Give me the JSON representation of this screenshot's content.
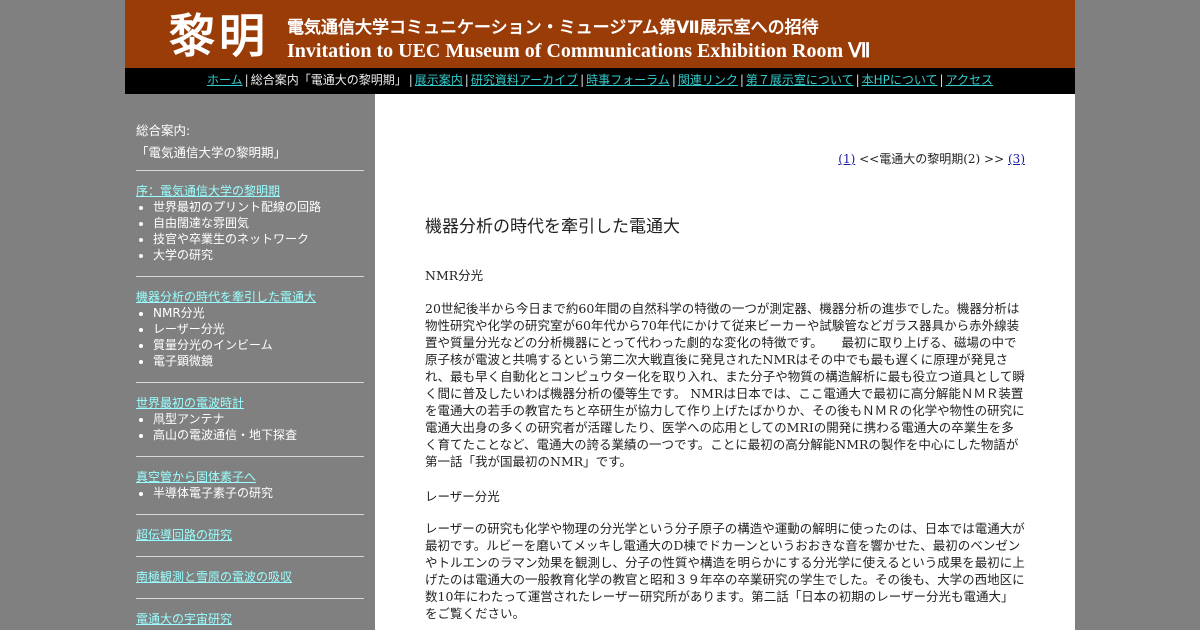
{
  "header": {
    "logo": "黎明",
    "title_jp": "電気通信大学コミュニケーション・ミュージアム第Ⅶ展示室への招待",
    "title_en": "Invitation to UEC Museum of Communications Exhibition Room Ⅶ"
  },
  "nav": {
    "home": "ホーム",
    "current": "総合案内「電通大の黎明期」",
    "items": [
      "展示案内",
      "研究資料アーカイブ",
      "時事フォーラム",
      "関連リンク",
      "第７展示室について",
      "本HPについて",
      "アクセス"
    ]
  },
  "sidebar": {
    "title_line1": "総合案内:",
    "title_line2": "「電気通信大学の黎明期」",
    "sections": [
      {
        "link": "序：電気通信大学の黎明期",
        "items": [
          "世界最初のプリント配線の回路",
          "自由闊達な雰囲気",
          "技官や卒業生のネットワーク",
          "大学の研究"
        ]
      },
      {
        "link": "機器分析の時代を牽引した電通大",
        "items": [
          "NMR分光",
          "レーザー分光",
          "質量分光のインビーム",
          "電子顕微鏡"
        ]
      },
      {
        "link": "世界最初の電波時計",
        "items": [
          "凧型アンテナ",
          "高山の電波通信・地下探査"
        ]
      },
      {
        "link": "真空管から固体素子へ",
        "items": [
          "半導体電子素子の研究"
        ]
      },
      {
        "link": "超伝導回路の研究",
        "items": []
      },
      {
        "link": "南極観測と雪原の電波の吸収",
        "items": []
      },
      {
        "link": "電通大の宇宙研究",
        "items": []
      }
    ]
  },
  "content": {
    "pager_prev": "(1)",
    "pager_middle": "<<電通大の黎明期(2) >>",
    "pager_next": "(3)",
    "title": "機器分析の時代を牽引した電通大",
    "sub1": "NMR分光",
    "para1": "20世紀後半から今日まで約60年間の自然科学の特徴の一つが測定器、機器分析の進歩でした。機器分析は物性研究や化学の研究室が60年代から70年代にかけて従来ビーカーや試験管などガラス器具から赤外線装置や質量分光などの分析機器にとって代わった劇的な変化の特徴です。　　最初に取り上げる、磁場の中で原子核が電波と共鳴するという第二次大戦直後に発見されたNMRはその中でも最も遅くに原理が発見され、最も早く自動化とコンピュウター化を取り入れ、また分子や物質の構造解析に最も役立つ道具として瞬く間に普及したいわば機器分析の優等生です。 NMRは日本では、ここ電通大で最初に高分解能ＮＭＲ装置を電通大の若手の教官たちと卒研生が協力して作り上げたばかりか、その後もＮＭＲの化学や物性の研究に電通大出身の多くの研究者が活躍したり、医学への応用としてのMRIの開発に携わる電通大の卒業生を多く育てたことなど、電通大の誇る業績の一つです。ことに最初の高分解能NMRの製作を中心にした物語が第一話「我が国最初のNMR」です。",
    "sub2": "レーザー分光",
    "para2": "レーザーの研究も化学や物理の分光学という分子原子の構造や運動の解明に使ったのは、日本では電通大が最初です。ルビーを磨いてメッキし電通大のD棟でドカーンというおおきな音を響かせた、最初のベンゼンやトルエンのラマン効果を観測し、分子の性質や構造を明らかにする分光学に使えるという成果を最初に上げたのは電通大の一般教育化学の教官と昭和３９年卒の卒業研究の学生でした。その後も、大学の西地区に数10年にわたって運営されたレーザー研究所があります。第二話「日本の初期のレーザー分光も電通大」をご覧ください。"
  },
  "colors": {
    "banner": "#9a3c08",
    "nav_link": "#33cccc",
    "sidebar_link": "#99ffff"
  }
}
